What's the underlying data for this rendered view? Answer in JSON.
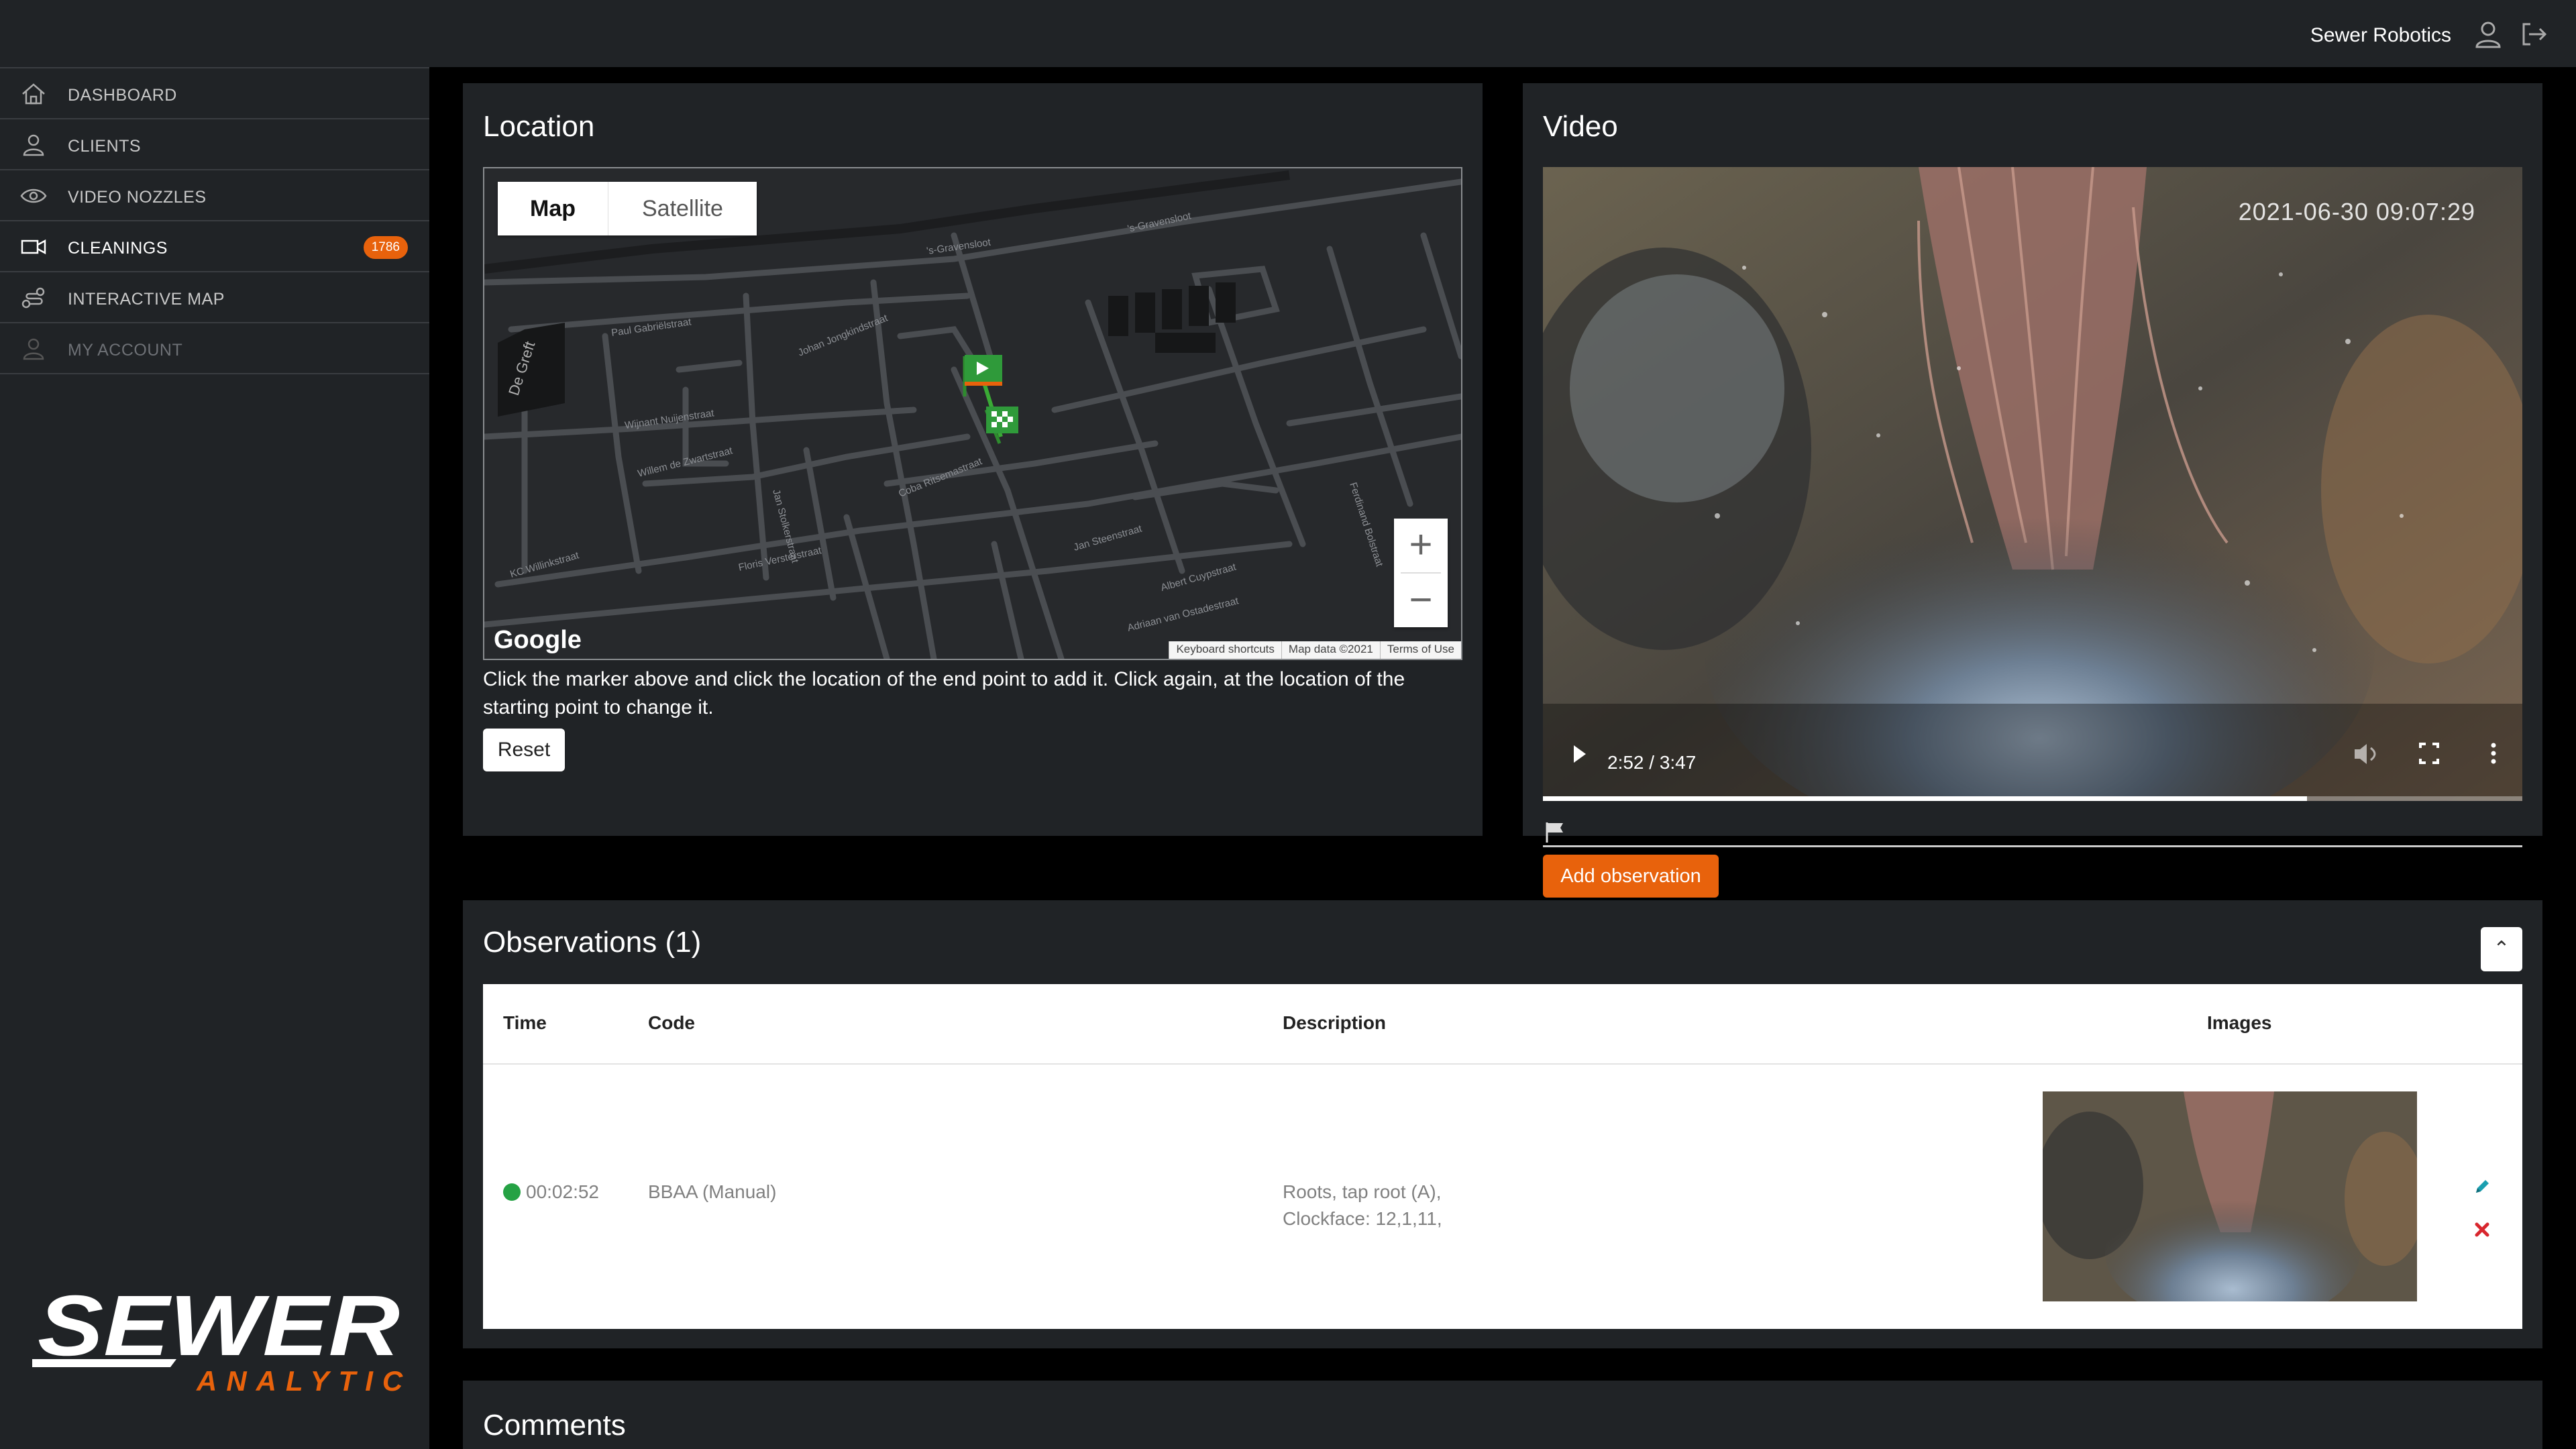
{
  "topbar": {
    "company": "Sewer Robotics",
    "icons": [
      "user-icon",
      "logout-icon"
    ]
  },
  "sidebar": {
    "items": [
      {
        "label": "DASHBOARD",
        "icon": "home-icon"
      },
      {
        "label": "CLIENTS",
        "icon": "user-icon"
      },
      {
        "label": "VIDEO NOZZLES",
        "icon": "eye-icon"
      },
      {
        "label": "CLEANINGS",
        "icon": "video-camera-icon",
        "badge": "1786",
        "active": true
      },
      {
        "label": "INTERACTIVE MAP",
        "icon": "route-icon"
      },
      {
        "label": "MY ACCOUNT",
        "icon": "user-icon",
        "disabled": true
      }
    ],
    "logo": {
      "primary": "SEWER",
      "secondary": "ANALYTICS"
    }
  },
  "location": {
    "title": "Location",
    "map_type_options": [
      "Map",
      "Satellite"
    ],
    "selected_map_type": "Map",
    "street_labels": [
      "'s-Gravensloot",
      "'s-Gravensloot",
      "Paul Gabriëlstraat",
      "Johan Jongkindstraat",
      "Wijnant Nuijenstraat",
      "Jan Stolkerstraat",
      "Willem de Zwartstraat",
      "Coba Ritsemastraat",
      "Jan Steenstraat",
      "Albert Cuypstraat",
      "Floris Versterstraat",
      "Adriaan van Ostadestraat",
      "De Greft",
      "KC Willinkstraat",
      "Ferdinand Bolstraat"
    ],
    "google_label": "Google",
    "attribution": [
      "Keyboard shortcuts",
      "Map data ©2021",
      "Terms of Use"
    ],
    "zoom_in": "+",
    "zoom_out": "−",
    "help_text": "Click the marker above and click the location of the end point to add it. Click again, at the location of the starting point to change it.",
    "reset_label": "Reset"
  },
  "video": {
    "title": "Video",
    "timestamp_overlay": "2021-06-30 09:07:29",
    "time_display": "2:52 / 3:47",
    "progress": 0.78,
    "add_observation_label": "Add observation"
  },
  "observations": {
    "title": "Observations (1)",
    "collapse_glyph": "⌃",
    "columns": {
      "time": "Time",
      "code": "Code",
      "description": "Description",
      "images": "Images"
    },
    "rows": [
      {
        "time": "00:02:52",
        "code": "BBAA (Manual)",
        "description_line1": "Roots, tap root (A),",
        "description_line2": "Clockface: 12,1,11,",
        "status_color": "#25a244"
      }
    ]
  },
  "comments": {
    "title": "Comments"
  },
  "colors": {
    "accent": "#e8620c",
    "panel": "#202326",
    "status_ok": "#25a244"
  }
}
